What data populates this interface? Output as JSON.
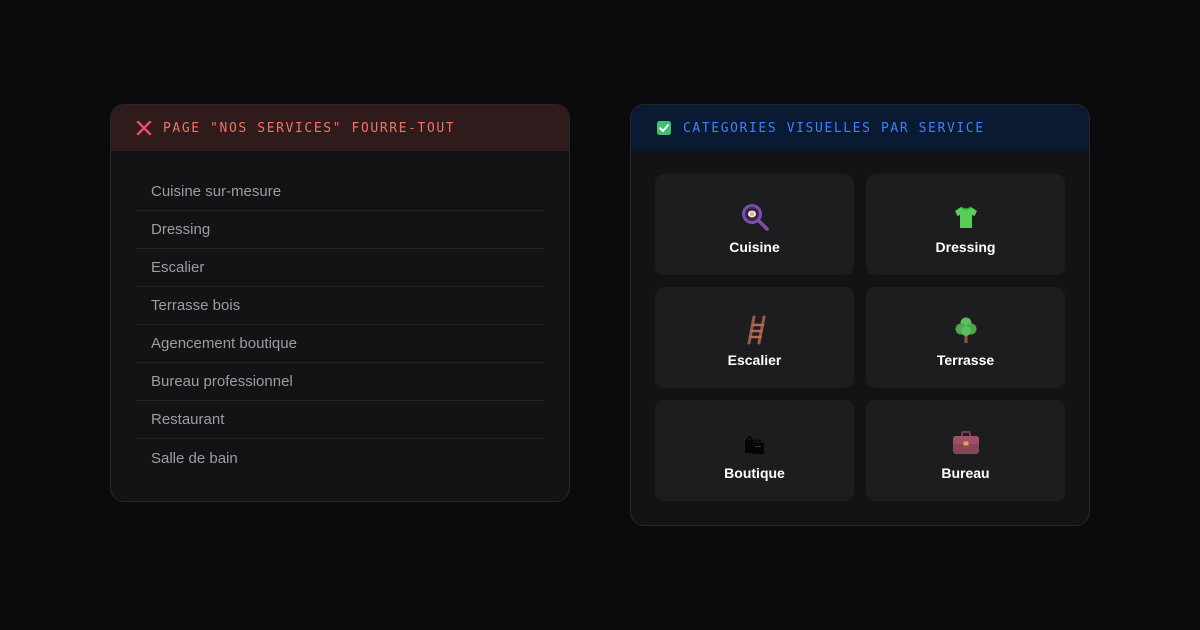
{
  "bad_panel": {
    "title": "PAGE \"NOS SERVICES\" FOURRE-TOUT",
    "icon": "cross-icon",
    "accent": "#f0745f",
    "items": [
      "Cuisine sur-mesure",
      "Dressing",
      "Escalier",
      "Terrasse bois",
      "Agencement boutique",
      "Bureau professionnel",
      "Restaurant",
      "Salle de bain"
    ]
  },
  "good_panel": {
    "title": "CATEGORIES VISUELLES PAR SERVICE",
    "icon": "checkmark-box-icon",
    "accent": "#3f7ff7",
    "cards": [
      {
        "label": "Cuisine",
        "icon": "frying-pan-icon"
      },
      {
        "label": "Dressing",
        "icon": "tshirt-icon"
      },
      {
        "label": "Escalier",
        "icon": "ladder-icon"
      },
      {
        "label": "Terrasse",
        "icon": "tree-icon"
      },
      {
        "label": "Boutique",
        "icon": "shopping-bags-icon"
      },
      {
        "label": "Bureau",
        "icon": "briefcase-icon"
      }
    ]
  }
}
